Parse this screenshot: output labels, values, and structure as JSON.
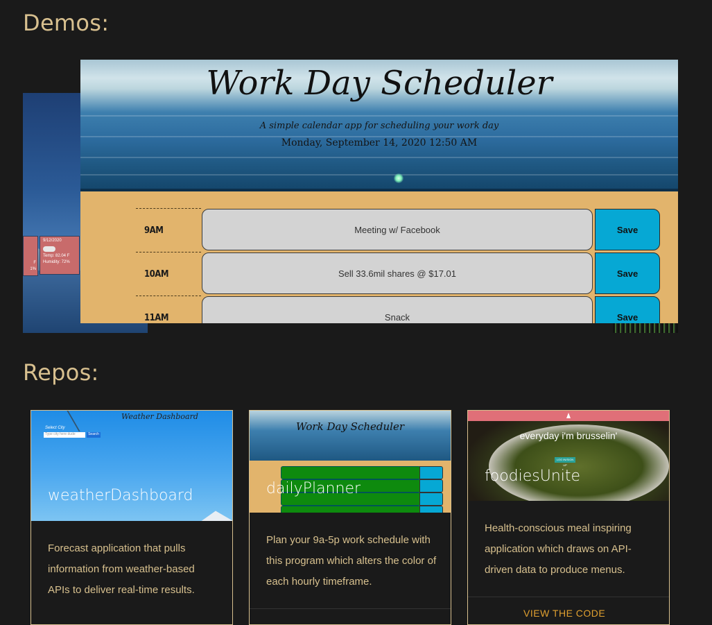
{
  "sections": {
    "demos_heading": "Demos:",
    "repos_heading": "Repos:"
  },
  "demo_back": {
    "date": "9/12/2020",
    "temp": "Temp: 82.04 F",
    "humidity": "Humidity: 72%",
    "partial_left_a": "F",
    "partial_left_b": "1%"
  },
  "demo_front": {
    "title": "Work Day Scheduler",
    "subtitle": "A simple calendar app for scheduling your work day",
    "date": "Monday, September 14, 2020 12:50 AM",
    "rows": [
      {
        "hour": "9AM",
        "entry": "Meeting w/ Facebook",
        "save": "Save"
      },
      {
        "hour": "10AM",
        "entry": "Sell 33.6mil shares @ $17.01",
        "save": "Save"
      },
      {
        "hour": "11AM",
        "entry": "Snack",
        "save": "Save"
      }
    ]
  },
  "repos": [
    {
      "name": "weatherDashboard",
      "description": "Forecast application that pulls information from weather-based APIs to deliver real-time results.",
      "thumb_title": "Weather Dashboard",
      "thumb_label": "Select City",
      "thumb_placeholder": "Type city here dude",
      "thumb_button": "Search"
    },
    {
      "name": "dailyPlanner",
      "description": "Plan your 9a-5p work schedule with this program which alters the color of each hourly timeframe.",
      "thumb_title": "Work Day Scheduler"
    },
    {
      "name": "foodiesUnite",
      "description": "Health-conscious meal inspiring application which draws on API-driven data to produce menus.",
      "thumb_tagline": "everyday i'm brusselin'",
      "thumb_pill": "LOG IN/SIGN UP",
      "link": "VIEW THE CODE"
    }
  ],
  "colors": {
    "background": "#1a1a1a",
    "accent_text": "#d8c08f",
    "link": "#e0a030",
    "save_button": "#06a8d4"
  }
}
